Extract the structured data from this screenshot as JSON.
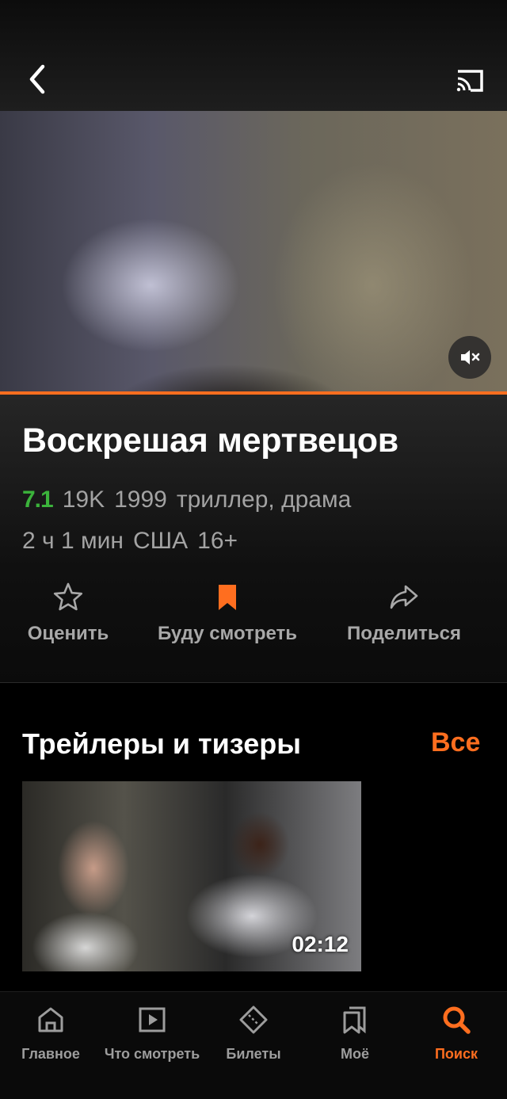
{
  "header": {
    "back_icon": "back-arrow-icon",
    "cast_icon": "cast-icon"
  },
  "player": {
    "mute_icon": "mute-icon",
    "progress_fraction": 1.0,
    "accent": "#ff6e1f"
  },
  "movie": {
    "title": "Воскрешая мертвецов",
    "rating": "7.1",
    "votes": "19K",
    "year": "1999",
    "genres": "триллер, драма",
    "duration": "2 ч 1 мин",
    "country": "США",
    "age": "16+",
    "rating_color": "#3bb33b"
  },
  "actions": [
    {
      "label": "Оценить",
      "icon": "star-icon"
    },
    {
      "label": "Буду смотреть",
      "icon": "bookmark-icon"
    },
    {
      "label": "Поделиться",
      "icon": "share-icon"
    }
  ],
  "trailers": {
    "title": "Трейлеры и тизеры",
    "all_label": "Все",
    "items": [
      {
        "duration": "02:12"
      }
    ]
  },
  "nav": [
    {
      "label": "Главное",
      "icon": "home-icon"
    },
    {
      "label": "Что смотреть",
      "icon": "play-icon"
    },
    {
      "label": "Билеты",
      "icon": "ticket-icon"
    },
    {
      "label": "Моё",
      "icon": "bookmarks-icon"
    },
    {
      "label": "Поиск",
      "icon": "search-icon",
      "active": true
    }
  ]
}
